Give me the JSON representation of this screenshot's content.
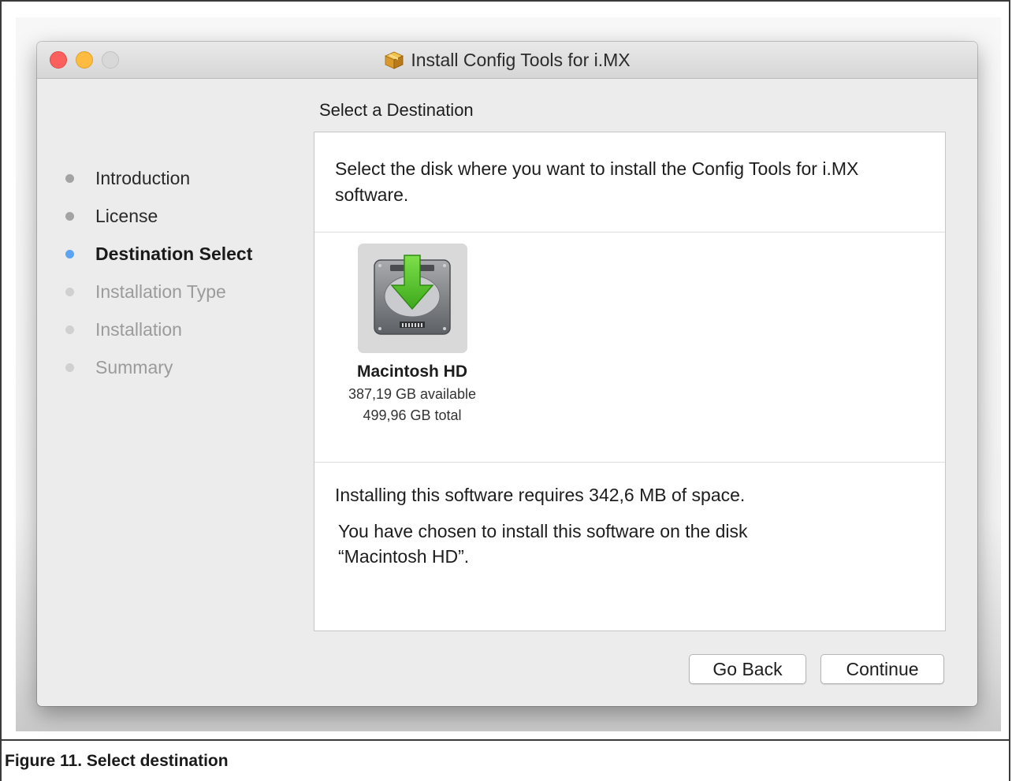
{
  "window": {
    "title": "Install Config Tools for i.MX",
    "icon": "package-icon"
  },
  "sidebar": {
    "steps": [
      {
        "label": "Introduction",
        "state": "done"
      },
      {
        "label": "License",
        "state": "done"
      },
      {
        "label": "Destination Select",
        "state": "current"
      },
      {
        "label": "Installation Type",
        "state": "future"
      },
      {
        "label": "Installation",
        "state": "future"
      },
      {
        "label": "Summary",
        "state": "future"
      }
    ]
  },
  "main": {
    "heading": "Select a Destination",
    "intro": "Select the disk where you want to install the Config Tools for i.MX software.",
    "disk": {
      "icon": "hard-drive-download-icon",
      "name": "Macintosh HD",
      "available": "387,19 GB available",
      "total": "499,96 GB total"
    },
    "requirement": "Installing this software requires 342,6 MB of space.",
    "chosen_line1": "You have chosen to install this software on the disk",
    "chosen_line2": "“Macintosh HD”."
  },
  "buttons": {
    "back": "Go Back",
    "continue": "Continue"
  },
  "caption": "Figure 11.  Select destination",
  "colors": {
    "current_step": "#5ba4f3",
    "close": "#fc605c",
    "minimize": "#fdbc40",
    "download_arrow": "#6dd23a"
  }
}
